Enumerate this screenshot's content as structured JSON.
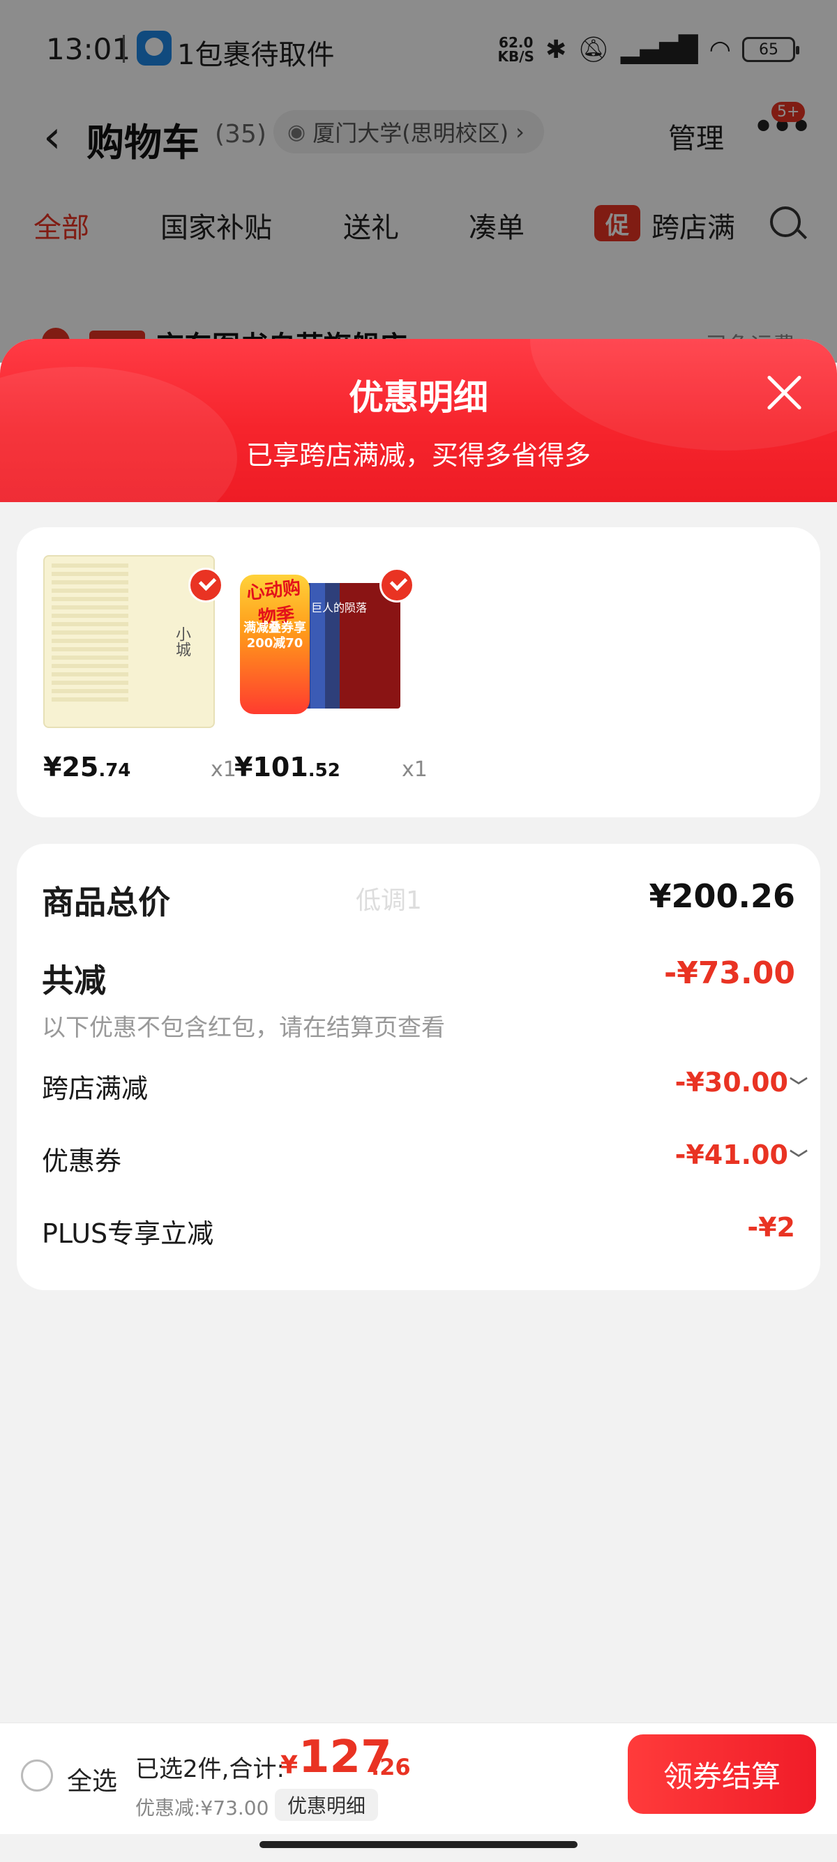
{
  "status_bar": {
    "time": "13:01",
    "notification": "1包裹待取件",
    "net_speed_value": "62.0",
    "net_speed_unit": "KB/S",
    "battery": "65",
    "icons": [
      "bluetooth-icon",
      "mute-icon",
      "signal-icon",
      "wifi-icon"
    ]
  },
  "nav": {
    "title": "购物车",
    "count": "(35)",
    "location": "厦门大学(思明校区)",
    "location_chevron": "›",
    "manage": "管理",
    "more_badge": "5+"
  },
  "tabs": [
    {
      "label": "全部",
      "active": true
    },
    {
      "label": "国家补贴",
      "active": false
    },
    {
      "label": "送礼",
      "active": false
    },
    {
      "label": "凑单",
      "active": false
    },
    {
      "label": "跨店满",
      "active": false
    }
  ],
  "promo_tag": "促",
  "shop_peek": {
    "name": "京东图书自营旗舰店",
    "right": "已免运费"
  },
  "sheet": {
    "title": "优惠明细",
    "subtitle": "已享跨店满减，买得多省得多"
  },
  "products": [
    {
      "price_symbol": "¥",
      "price_int": "25",
      "price_dec": ".74",
      "qty": "x1",
      "thumb_text": "小城"
    },
    {
      "price_symbol": "¥",
      "price_int": "101",
      "price_dec": ".52",
      "qty": "x1",
      "thumb_promo_top": "心动购物季",
      "thumb_promo_mid": "满减叠券享200减70",
      "thumb_box_label": "巨人的陨落"
    }
  ],
  "summary": {
    "total_label": "商品总价",
    "total_value": "¥200.26",
    "watermark": "低调1",
    "reduce_label": "共减",
    "reduce_value": "-¥73.00",
    "reduce_note": "以下优惠不包含红包，请在结算页查看",
    "items": [
      {
        "label": "跨店满减",
        "value": "-¥30.00",
        "expandable": true
      },
      {
        "label": "优惠券",
        "value": "-¥41.00",
        "expandable": true
      },
      {
        "label": "PLUS专享立减",
        "value": "-¥2",
        "expandable": false
      }
    ]
  },
  "checkout": {
    "select_all": "全选",
    "selected_text": "已选2件,合计:",
    "total_symbol": "¥",
    "total_int": "127",
    "total_dec": ".26",
    "discount_text": "优惠减:¥73.00",
    "detail_chip": "优惠明细",
    "button": "领券结算"
  },
  "colors": {
    "accent": "#e93323",
    "header_gradient_start": "#ff3b45",
    "header_gradient_end": "#ee1c25"
  }
}
